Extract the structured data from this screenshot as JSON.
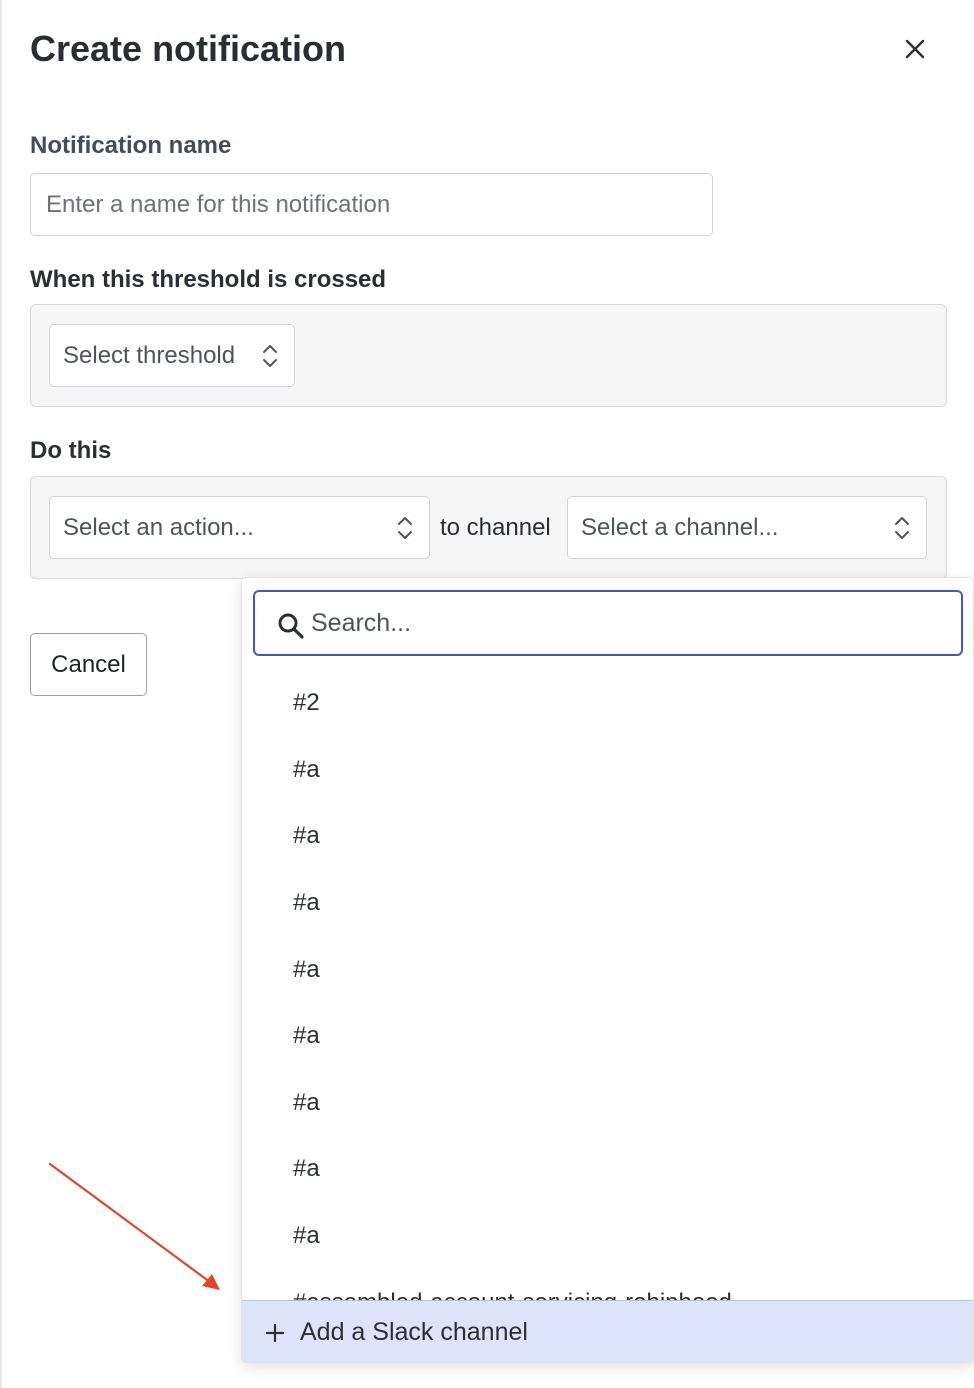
{
  "dialog": {
    "title": "Create notification"
  },
  "notification_name": {
    "label": "Notification name",
    "placeholder": "Enter a name for this notification",
    "value": ""
  },
  "threshold": {
    "label": "When this threshold is crossed",
    "select_placeholder": "Select threshold"
  },
  "action": {
    "label": "Do this",
    "action_placeholder": "Select an action...",
    "connector": "to channel",
    "channel_placeholder": "Select a channel..."
  },
  "buttons": {
    "cancel": "Cancel"
  },
  "channel_dropdown": {
    "search_placeholder": "Search...",
    "items": [
      "#2",
      "#a",
      "#a",
      "#a",
      "#a",
      "#a",
      "#a",
      "#a",
      "#a",
      "#assembled-account-servicing-robinhood"
    ],
    "add_label": "Add a Slack channel"
  },
  "colors": {
    "focus_border": "#3d5bc2",
    "add_row_bg": "#dde4fa",
    "annotation_arrow": "#e0452b"
  },
  "icons": {
    "close": "close-icon",
    "select": "chevron-up-down-icon",
    "search": "search-icon",
    "add": "plus-icon",
    "annotation": "arrow-icon"
  }
}
